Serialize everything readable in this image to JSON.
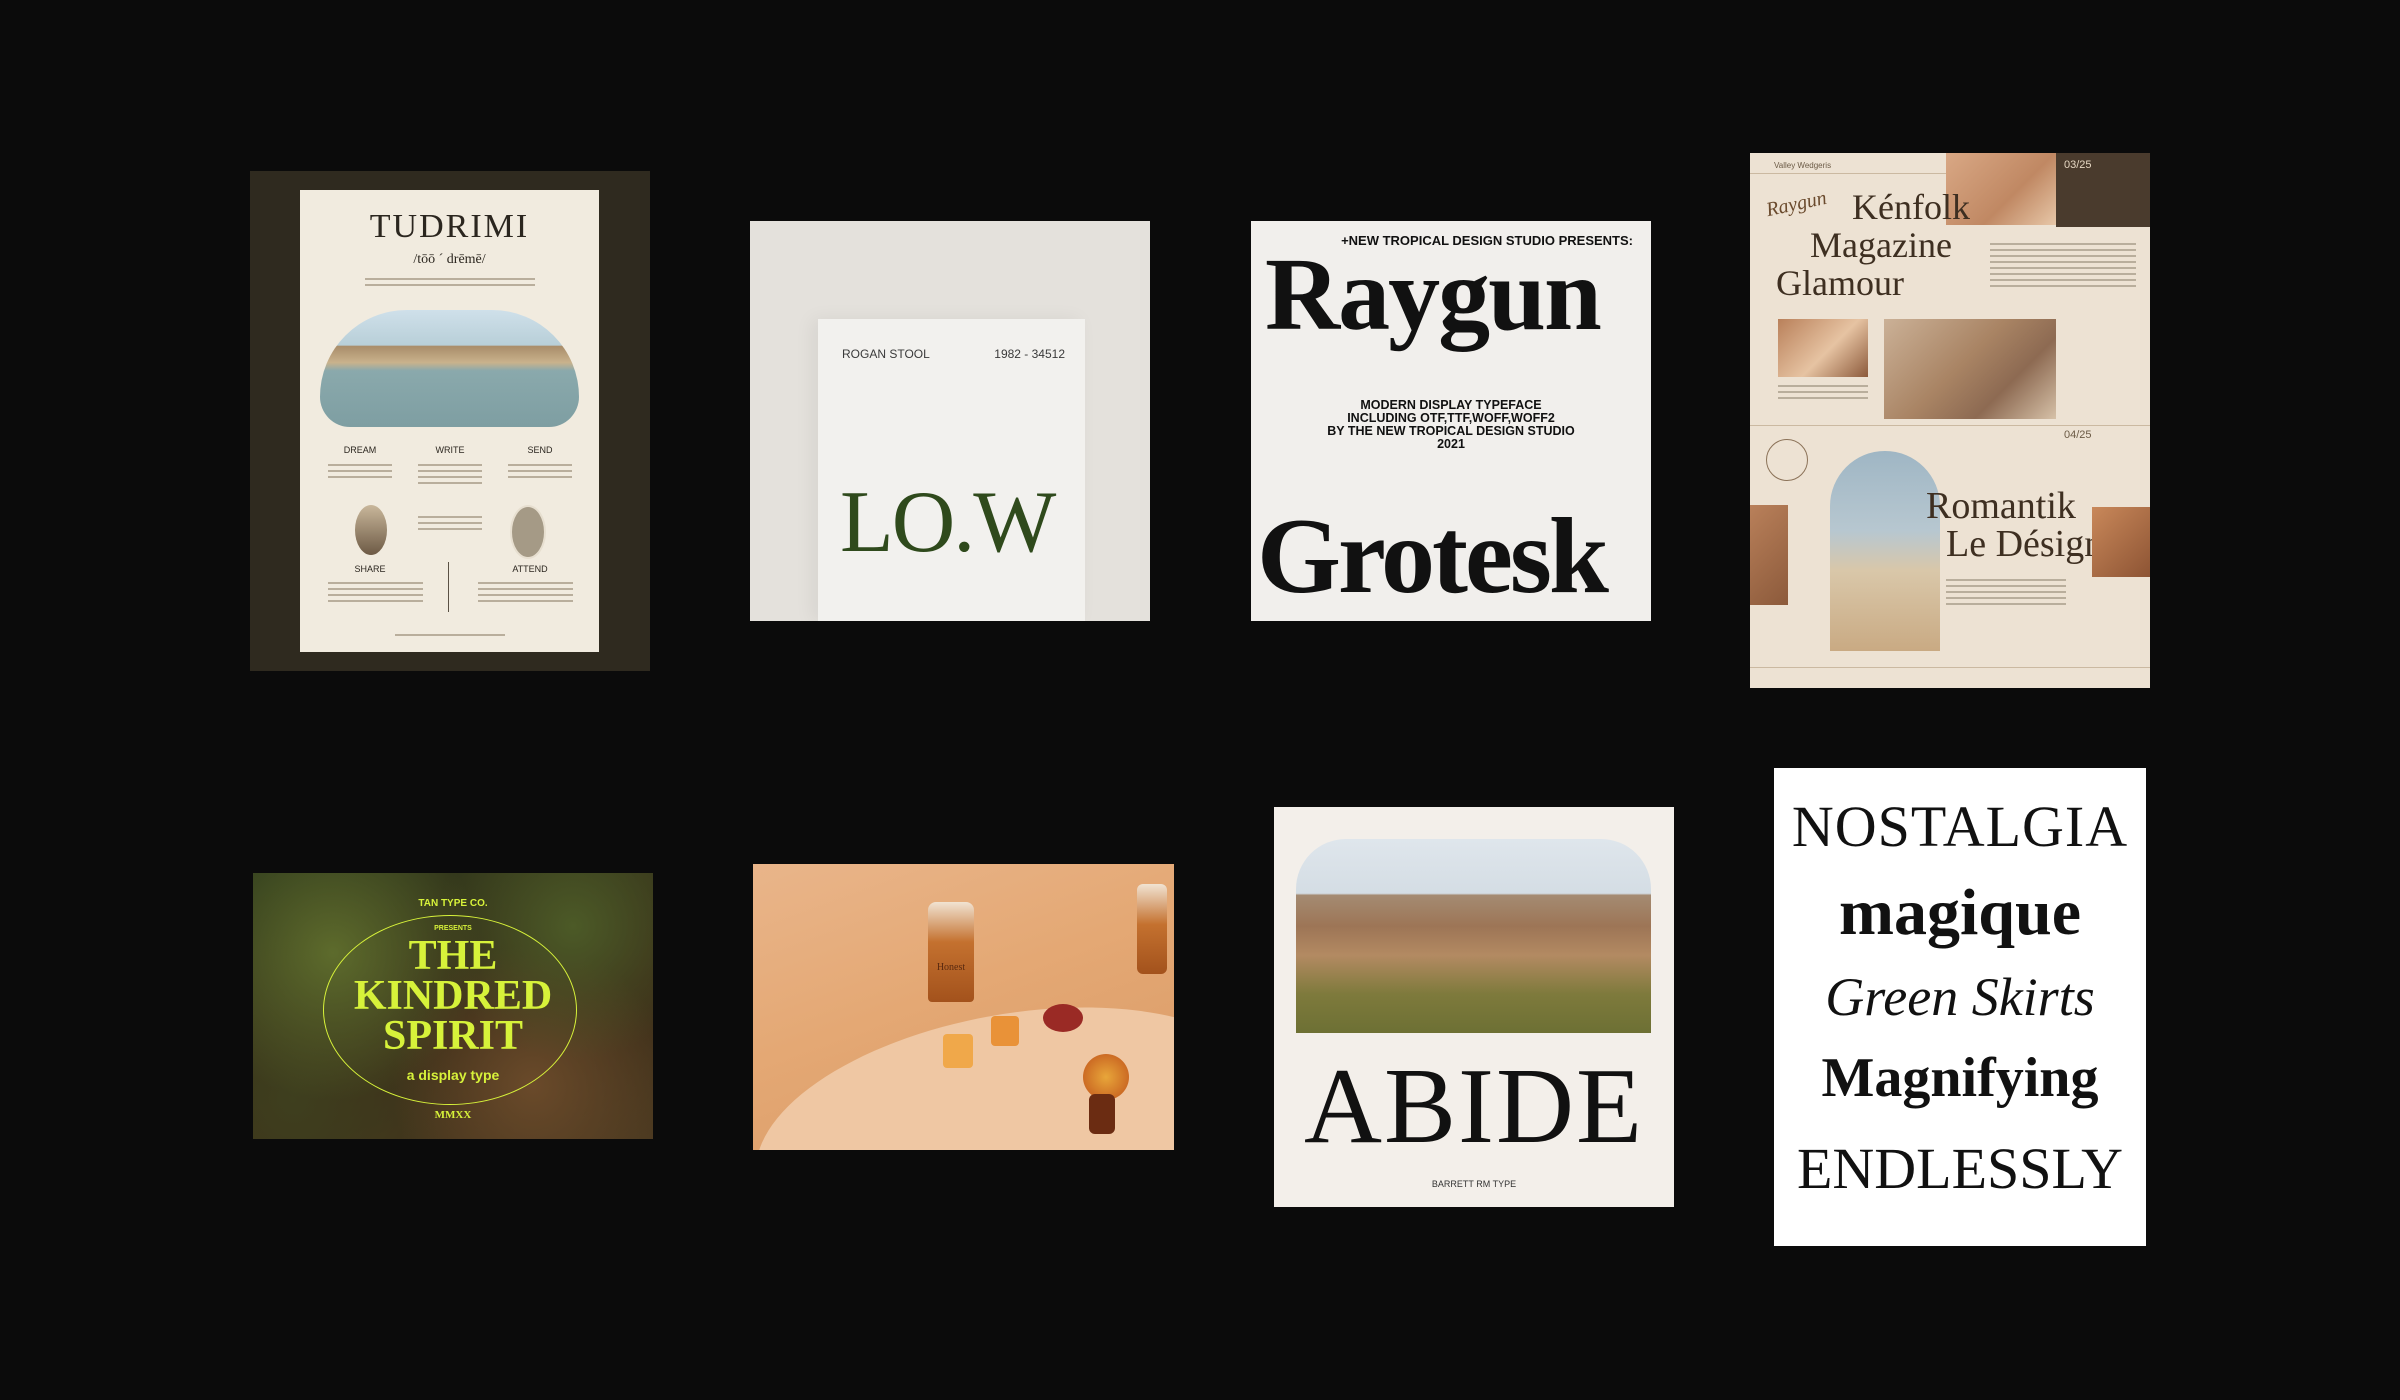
{
  "cards": {
    "tudrimi": {
      "title": "TUDRIMI",
      "phonetic": "/tōō ´ drēmē/",
      "steps": [
        "DREAM",
        "WRITE",
        "SEND"
      ],
      "steps2": [
        "SHARE",
        "ATTEND"
      ]
    },
    "low": {
      "product": "ROGAN STOOL",
      "code": "1982 - 34512",
      "mark": "LO.W"
    },
    "raygun": {
      "presents": "+NEW TROPICAL DESIGN STUDIO PRESENTS:",
      "title": "Raygun",
      "line1": "MODERN  DISPLAY TYPEFACE",
      "line2": "INCLUDING OTF,TTF,WOFF,WOFF2",
      "line3": "BY THE NEW TROPICAL DESIGN STUDIO",
      "line4": "2021",
      "subtitle": "Grotesk"
    },
    "kenfolk": {
      "brand": "Valley Wedgeris",
      "script": "Raygun",
      "headline1": "Kénfolk",
      "headline2": "Magazine",
      "headline3": "Glamour",
      "page1": "03/25",
      "page2": "04/25",
      "headline4": "Romantik",
      "headline5": "Le Désign"
    },
    "kindred": {
      "studio": "TAN TYPE CO.",
      "presents": "PRESENTS",
      "line1": "THE",
      "line2": "KINDRED",
      "line3": "SPIRIT",
      "tagline": "a display type",
      "year": "MMXX"
    },
    "honest": {
      "label": "Honest"
    },
    "abide": {
      "title": "ABIDE",
      "credit": "BARRETT RM TYPE"
    },
    "nostalgia": {
      "words": [
        "NOSTALGIA",
        "magique",
        "Green Skirts",
        "Magnifying",
        "ENDLESSLY"
      ]
    }
  },
  "colors": {
    "background": "#0b0b0b",
    "kindred_accent": "#d7f23a",
    "low_green": "#2f4a1c"
  }
}
